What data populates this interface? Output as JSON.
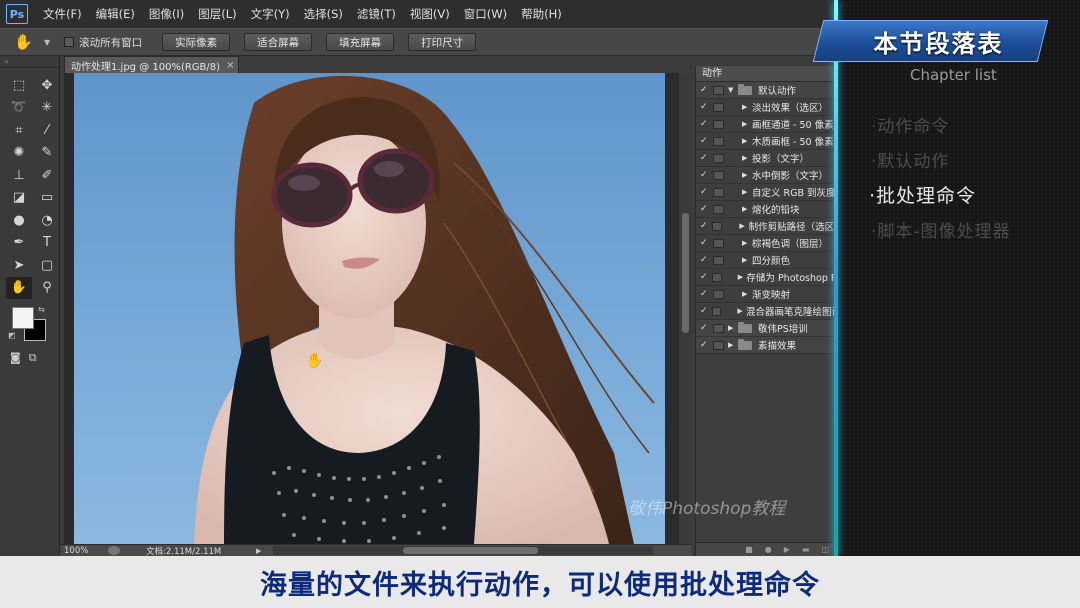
{
  "app": {
    "logo": "Ps"
  },
  "menu": [
    "文件(F)",
    "编辑(E)",
    "图像(I)",
    "图层(L)",
    "文字(Y)",
    "选择(S)",
    "滤镜(T)",
    "视图(V)",
    "窗口(W)",
    "帮助(H)"
  ],
  "options_bar": {
    "scroll_all_label": "滚动所有窗口",
    "buttons": [
      "实际像素",
      "适合屏幕",
      "填充屏幕",
      "打印尺寸"
    ]
  },
  "document": {
    "tab_label": "动作处理1.jpg @ 100%(RGB/8)",
    "zoom": "100%",
    "doc_size": "文档:2.11M/2.11M"
  },
  "actions_panel": {
    "tab": "动作",
    "rows": [
      {
        "label": "默认动作",
        "kind": "set",
        "expanded": true
      },
      {
        "label": "淡出效果（选区）",
        "kind": "action"
      },
      {
        "label": "画框通道 - 50 像素",
        "kind": "action"
      },
      {
        "label": "木质画框 - 50 像素",
        "kind": "action"
      },
      {
        "label": "投影（文字）",
        "kind": "action"
      },
      {
        "label": "水中倒影（文字）",
        "kind": "action"
      },
      {
        "label": "自定义 RGB 到灰度",
        "kind": "action"
      },
      {
        "label": "熔化的铅块",
        "kind": "action"
      },
      {
        "label": "制作剪贴路径（选区）",
        "kind": "action"
      },
      {
        "label": "棕褐色调（图层）",
        "kind": "action"
      },
      {
        "label": "四分颜色",
        "kind": "action"
      },
      {
        "label": "存储为 Photoshop PDF",
        "kind": "action"
      },
      {
        "label": "渐变映射",
        "kind": "action"
      },
      {
        "label": "混合器画笔克隆绘图设置",
        "kind": "action"
      },
      {
        "label": "敬伟PS培训",
        "kind": "set",
        "expanded": false
      },
      {
        "label": "素描效果",
        "kind": "set",
        "expanded": false
      }
    ]
  },
  "chapter": {
    "title": "本节段落表",
    "subtitle": "Chapter list",
    "items": [
      {
        "label": "·动作命令",
        "active": false
      },
      {
        "label": "·默认动作",
        "active": false
      },
      {
        "label": "·批处理命令",
        "active": true
      },
      {
        "label": "·脚本-图像处理器",
        "active": false
      }
    ]
  },
  "watermark": "敬伟Photoshop教程",
  "subtitle": "海量的文件来执行动作，可以使用批处理命令",
  "colors": {
    "accent": "#1d4f9a",
    "subtitle_text": "#0d2b7a"
  }
}
